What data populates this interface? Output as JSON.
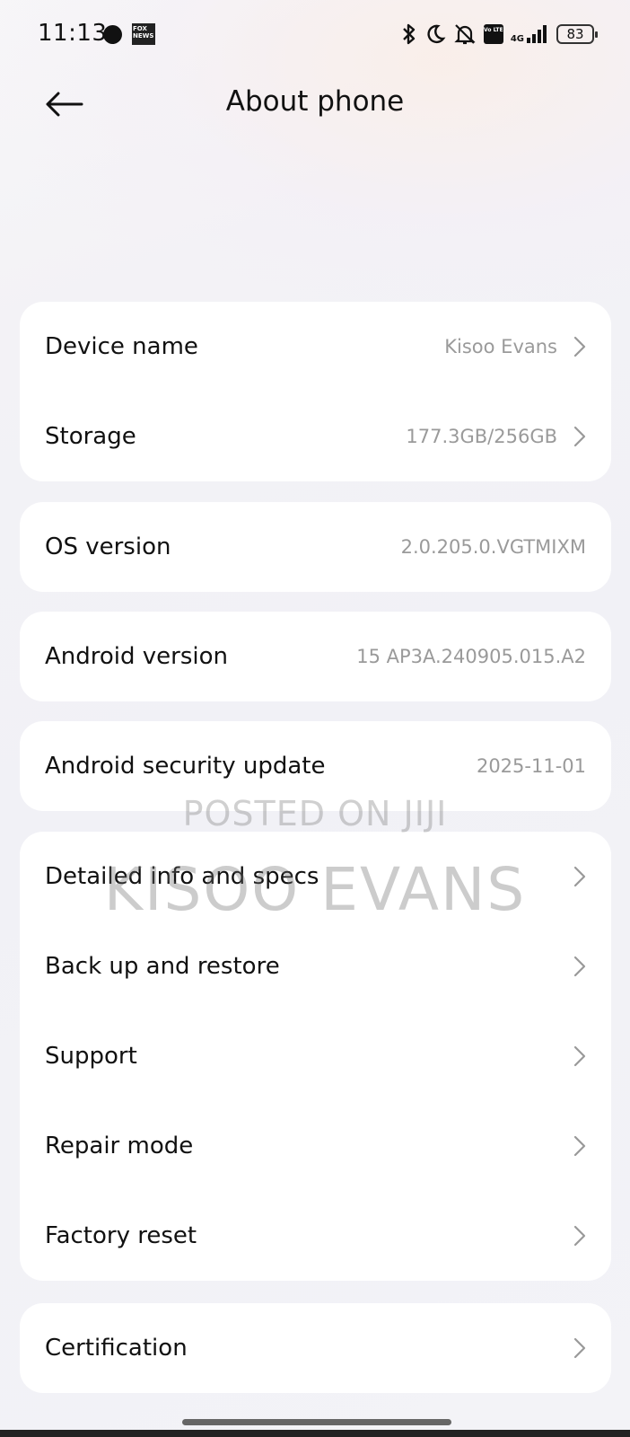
{
  "status_bar": {
    "time": "11:13",
    "battery": "83",
    "network": "4G",
    "volte": "Vo LTE",
    "icons": [
      "bluetooth-icon",
      "moon-icon",
      "bell-off-icon",
      "volte-icon",
      "signal-icon",
      "battery-icon"
    ],
    "notification_app": "FOX NEWS"
  },
  "header": {
    "title": "About phone"
  },
  "groups": [
    {
      "rows": [
        {
          "label": "Device name",
          "value": "Kisoo Evans",
          "chevron": true
        },
        {
          "label": "Storage",
          "value": "177.3GB/256GB",
          "chevron": true
        }
      ]
    },
    {
      "rows": [
        {
          "label": "OS version",
          "value": "2.0.205.0.VGTMIXM",
          "chevron": false
        }
      ]
    },
    {
      "rows": [
        {
          "label": "Android version",
          "value": "15 AP3A.240905.015.A2",
          "chevron": false
        }
      ]
    },
    {
      "rows": [
        {
          "label": "Android security update",
          "value": "2025-11-01",
          "chevron": false
        }
      ]
    },
    {
      "rows": [
        {
          "label": "Detailed info and specs",
          "chevron": true
        },
        {
          "label": "Back up and restore",
          "chevron": true
        },
        {
          "label": "Support",
          "chevron": true
        },
        {
          "label": "Repair mode",
          "chevron": true
        },
        {
          "label": "Factory reset",
          "chevron": true
        }
      ]
    },
    {
      "rows": [
        {
          "label": "Certification",
          "chevron": true
        }
      ]
    }
  ],
  "watermark": {
    "line1": "POSTED ON JIJI",
    "line2": "KISOO EVANS"
  }
}
